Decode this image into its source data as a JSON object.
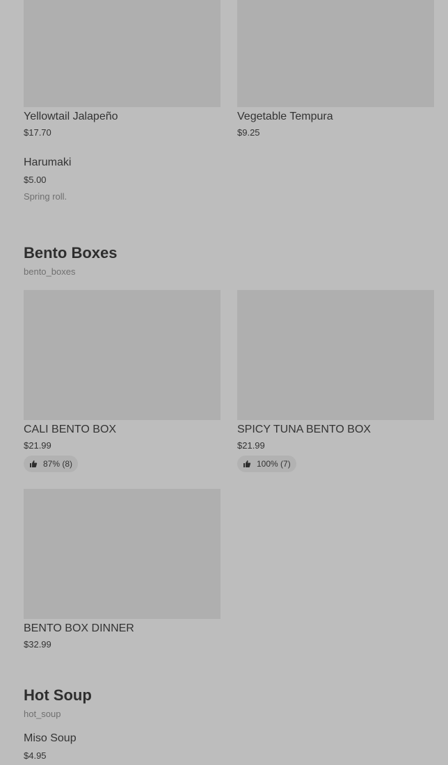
{
  "sections": [
    {
      "items": [
        {
          "name": "Yellowtail Jalapeño",
          "price": "$17.70",
          "image": "food-photo-placeholder"
        },
        {
          "name": "Vegetable Tempura",
          "price": "$9.25",
          "image": "food-photo-placeholder"
        },
        {
          "name": "Harumaki",
          "price": "$5.00",
          "description": "Spring roll."
        }
      ]
    },
    {
      "title": "Bento Boxes",
      "id": "bento_boxes",
      "items": [
        {
          "name": "CALI BENTO BOX",
          "price": "$21.99",
          "rating": "87% (8)",
          "rating_icon": "thumbs-up-icon",
          "image": "food-photo-placeholder"
        },
        {
          "name": "SPICY TUNA BENTO BOX",
          "price": "$21.99",
          "rating": "100% (7)",
          "rating_icon": "thumbs-up-icon",
          "image": "food-photo-placeholder"
        },
        {
          "name": "BENTO BOX DINNER",
          "price": "$32.99",
          "image": "food-photo-placeholder"
        }
      ]
    },
    {
      "title": "Hot Soup",
      "id": "hot_soup",
      "items": [
        {
          "name": "Miso Soup",
          "price": "$4.95"
        }
      ]
    }
  ],
  "colors": {
    "background": "#bdbdbd",
    "image_placeholder": "#afafaf",
    "text": "#333333",
    "muted_text": "#6f6f6f",
    "badge": "#b2b2b2"
  }
}
